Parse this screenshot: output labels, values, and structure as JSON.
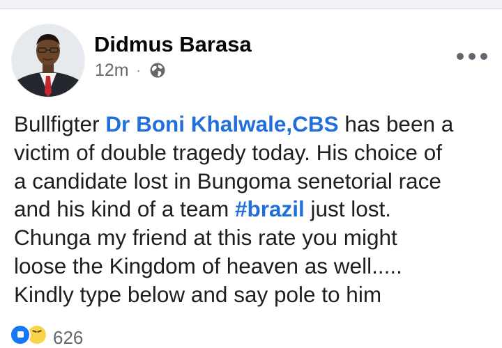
{
  "post": {
    "author": "Didmus Barasa",
    "timestamp": "12m",
    "separator": "·",
    "privacy_icon": "globe-icon",
    "more_icon": "more-options-icon",
    "text": {
      "line1_a": "Bullfigter ",
      "mention": "Dr Boni Khalwale,CBS",
      "line1_b": " has been a",
      "line2": "victim of double tragedy today. His choice of",
      "line3": "a candidate lost in Bungoma senetorial race",
      "line4_a": "and his kind of a team ",
      "hashtag": "#brazil",
      "line4_b": " just lost.",
      "line5": "Chunga my friend at this rate you might",
      "line6": "loose the Kingdom of heaven as well.....",
      "line7": "Kindly type below and say pole to him"
    },
    "reactions": {
      "icons": [
        "like-icon",
        "haha-icon"
      ],
      "count": "626"
    }
  },
  "colors": {
    "link": "#216fdb",
    "meta": "#65676b",
    "text": "#1c1e21"
  }
}
